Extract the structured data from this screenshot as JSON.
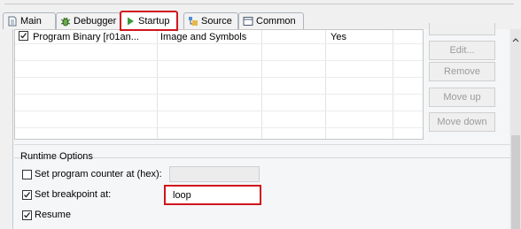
{
  "tabs": [
    {
      "label": "Main",
      "icon": "document-icon"
    },
    {
      "label": "Debugger",
      "icon": "bug-icon"
    },
    {
      "label": "Startup",
      "icon": "play-icon"
    },
    {
      "label": "Source",
      "icon": "source-icon"
    },
    {
      "label": "Common",
      "icon": "window-icon"
    }
  ],
  "table": {
    "rows": [
      {
        "checked": true,
        "name": "Program Binary [r01an...",
        "type": "Image and Symbols",
        "col3": "",
        "col4": "Yes"
      }
    ]
  },
  "buttons": {
    "top": "",
    "edit": "Edit...",
    "remove": "Remove",
    "move_up": "Move up",
    "move_down": "Move down"
  },
  "runtime": {
    "title": "Runtime Options",
    "set_pc": {
      "label": "Set program counter at (hex):",
      "checked": false,
      "value": ""
    },
    "set_bp": {
      "label": "Set breakpoint at:",
      "checked": true,
      "value": "loop"
    },
    "resume": {
      "label": "Resume",
      "checked": true
    }
  },
  "colors": {
    "highlight": "#d0151b"
  }
}
